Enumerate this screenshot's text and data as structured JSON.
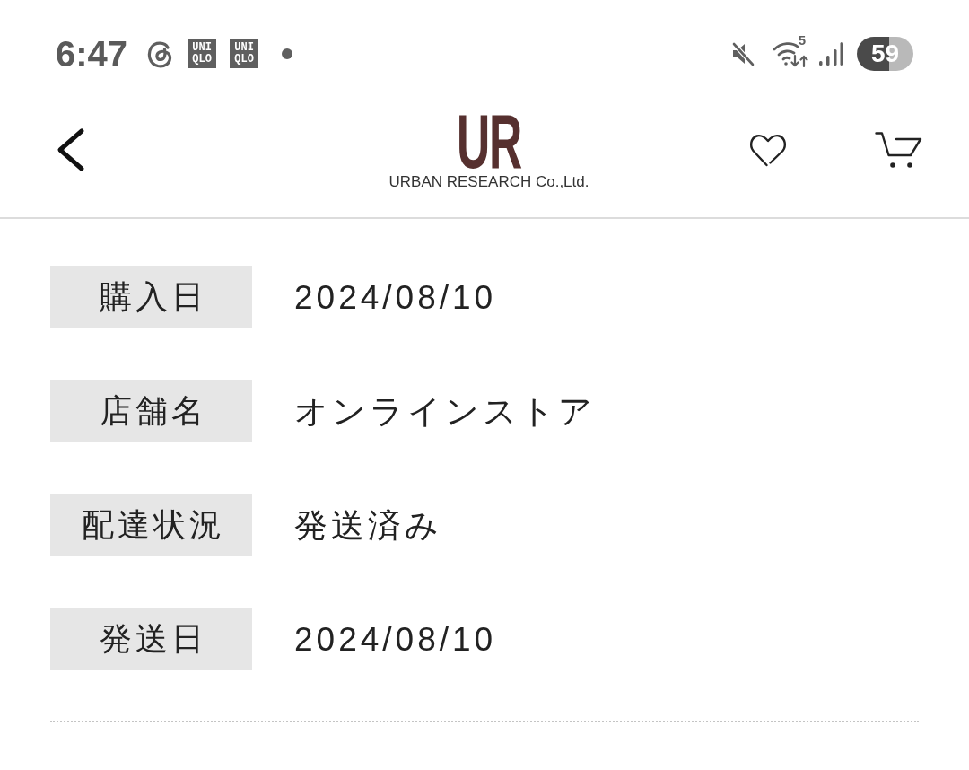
{
  "status_bar": {
    "time": "6:47",
    "notifications": [
      {
        "kind": "threads"
      },
      {
        "kind": "logo",
        "lines": [
          "UNI",
          "QLO"
        ]
      },
      {
        "kind": "logo",
        "lines": [
          "UNI",
          "QLO"
        ]
      },
      {
        "kind": "dot"
      }
    ],
    "wifi_badge": "5",
    "battery": "59"
  },
  "header": {
    "logo_mark": "UR",
    "logo_text": "URBAN RESEARCH Co.,Ltd."
  },
  "details": [
    {
      "label": "購入日",
      "value": "2024/08/10"
    },
    {
      "label": "店舗名",
      "value": "オンラインストア"
    },
    {
      "label": "配達状況",
      "value": "発送済み"
    },
    {
      "label": "発送日",
      "value": "2024/08/10"
    }
  ]
}
